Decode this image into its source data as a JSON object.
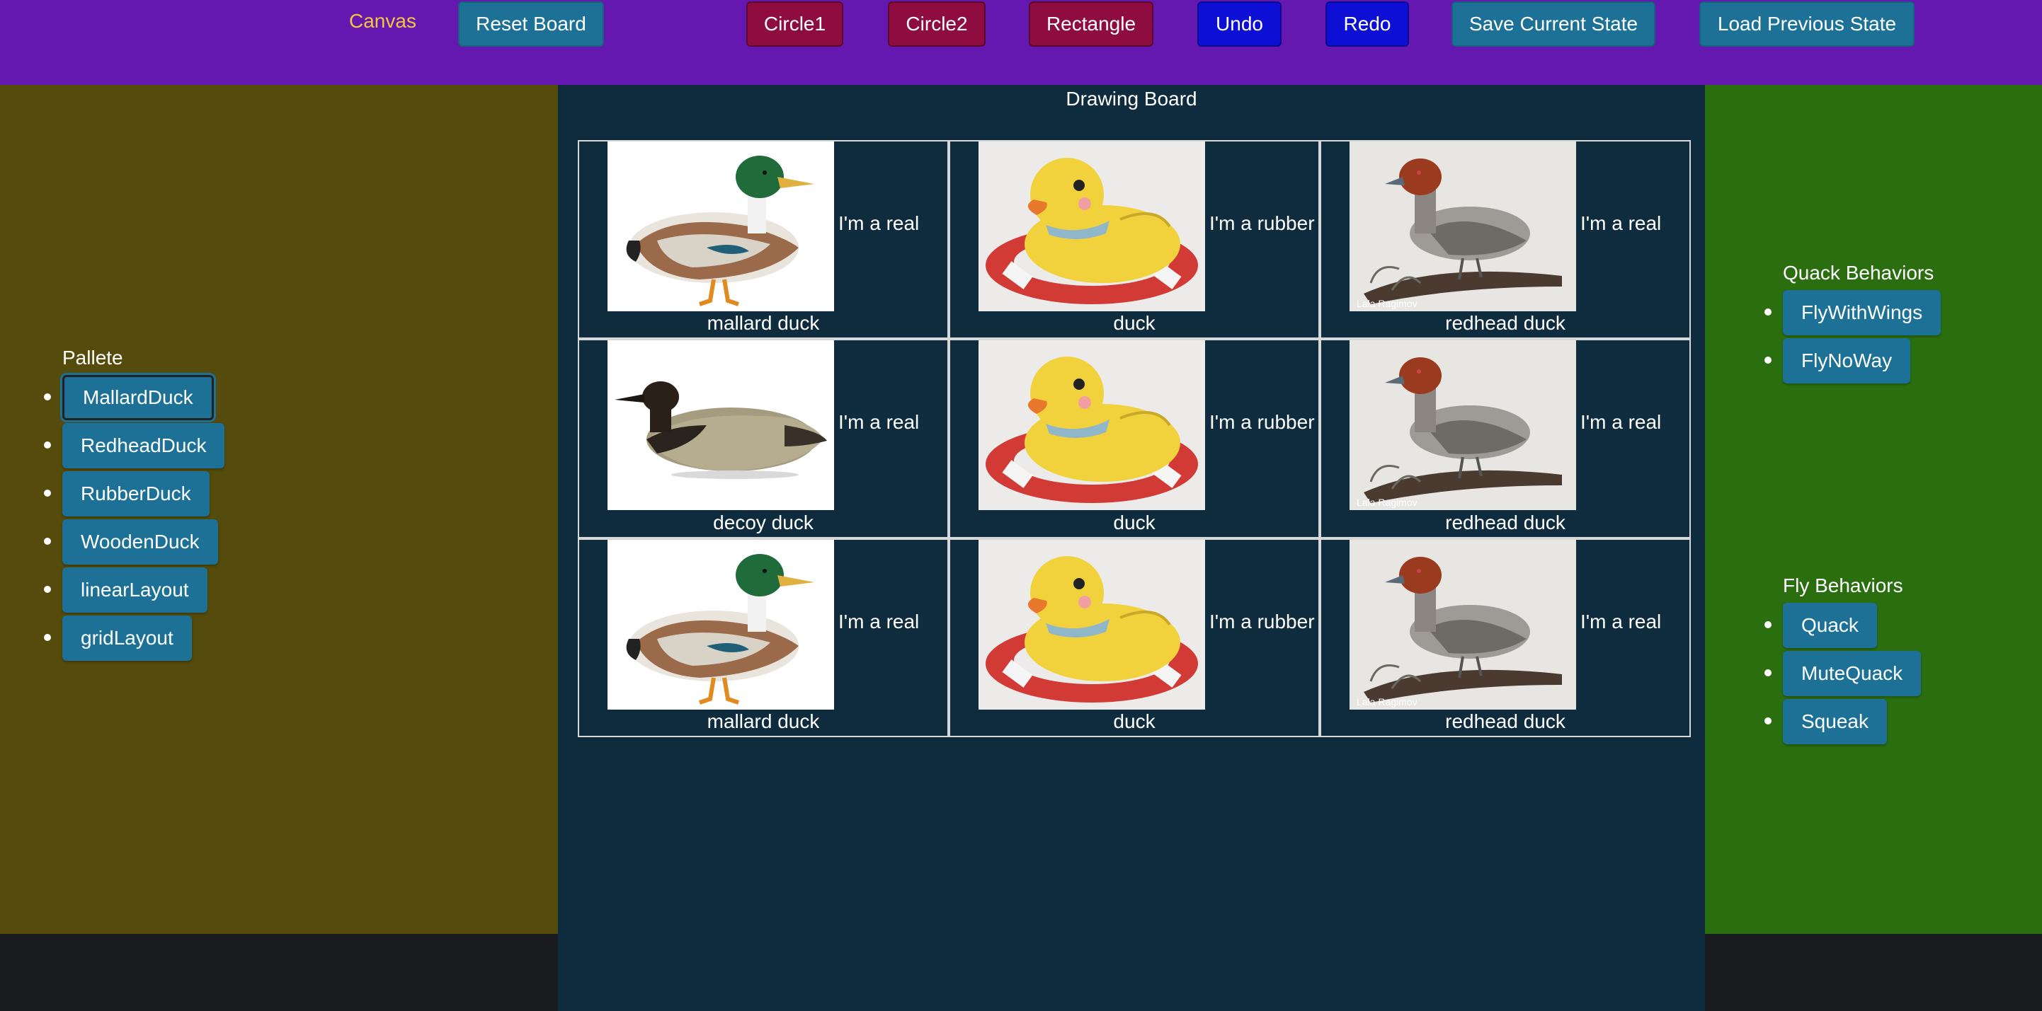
{
  "topbar": {
    "brand": "Canvas",
    "reset": "Reset Board",
    "circle1": "Circle1",
    "circle2": "Circle2",
    "rectangle": "Rectangle",
    "undo": "Undo",
    "redo": "Redo",
    "save": "Save Current State",
    "load": "Load Previous State"
  },
  "palette": {
    "title": "Pallete",
    "items": [
      "MallardDuck",
      "RedheadDuck",
      "RubberDuck",
      "WoodenDuck",
      "linearLayout",
      "gridLayout"
    ]
  },
  "board": {
    "title": "Drawing Board",
    "cells": [
      {
        "says": "I'm a real",
        "name": "mallard duck",
        "icon": "mallard-duck-image"
      },
      {
        "says": "I'm a rubber",
        "name": "duck",
        "icon": "rubber-duck-image"
      },
      {
        "says": "I'm a real",
        "name": "redhead duck",
        "icon": "redhead-duck-image",
        "credit": "Lala Ragimov"
      },
      {
        "says": "I'm a real",
        "name": "decoy duck",
        "icon": "decoy-duck-image"
      },
      {
        "says": "I'm a rubber",
        "name": "duck",
        "icon": "rubber-duck-image"
      },
      {
        "says": "I'm a real",
        "name": "redhead duck",
        "icon": "redhead-duck-image",
        "credit": "Lala Ragimov"
      },
      {
        "says": "I'm a real",
        "name": "mallard duck",
        "icon": "mallard-duck-image"
      },
      {
        "says": "I'm a rubber",
        "name": "duck",
        "icon": "rubber-duck-image"
      },
      {
        "says": "I'm a real",
        "name": "redhead duck",
        "icon": "redhead-duck-image",
        "credit": "Lala Ragimov"
      }
    ]
  },
  "quack": {
    "title": "Quack Behaviors",
    "items": [
      "FlyWithWings",
      "FlyNoWay"
    ]
  },
  "fly": {
    "title": "Fly Behaviors",
    "items": [
      "Quack",
      "MuteQuack",
      "Squeak"
    ]
  },
  "colors": {
    "topbar": "#6518b0",
    "left_panel": "#544b0c",
    "board": "#0f2c3e",
    "right_panel": "#2b6e10",
    "teal_button": "#1d7197",
    "shape_button": "#8e0c3f",
    "history_button": "#0d10d4",
    "brand": "#f5c542"
  }
}
